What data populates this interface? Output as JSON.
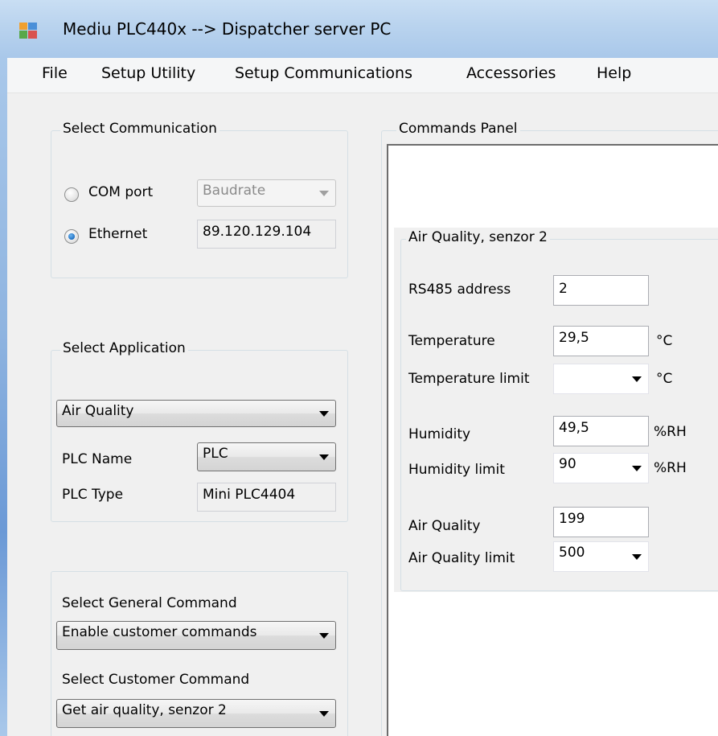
{
  "window": {
    "title": "Mediu PLC440x --> Dispatcher server PC"
  },
  "menu": {
    "file": "File",
    "setup_utility": "Setup Utility",
    "setup_communications": "Setup Communications",
    "accessories": "Accessories",
    "help": "Help"
  },
  "communication": {
    "title": "Select Communication",
    "com_port_label": "COM port",
    "baudrate_placeholder": "Baudrate",
    "ethernet_label": "Ethernet",
    "ip_address": "89.120.129.104",
    "selected": "Ethernet"
  },
  "application": {
    "title": "Select Application",
    "selected": "Air Quality",
    "plc_name_label": "PLC Name",
    "plc_name_value": "PLC",
    "plc_type_label": "PLC Type",
    "plc_type_value": "Mini PLC4404"
  },
  "commands": {
    "general_label": "Select General Command",
    "general_value": "Enable customer commands",
    "customer_label": "Select Customer Command",
    "customer_value": "Get air quality, senzor 2"
  },
  "commands_panel": {
    "title": "Commands Panel",
    "sensor_group": {
      "title": "Air Quality, senzor 2",
      "rs485_label": "RS485 address",
      "rs485_value": "2",
      "temperature_label": "Temperature",
      "temperature_value": "29,5",
      "temperature_unit": "°C",
      "temperature_limit_label": "Temperature limit",
      "temperature_limit_value": "",
      "temperature_limit_unit": "°C",
      "humidity_label": "Humidity",
      "humidity_value": "49,5",
      "humidity_unit": "%RH",
      "humidity_limit_label": "Humidity limit",
      "humidity_limit_value": "90",
      "humidity_limit_unit": "%RH",
      "air_quality_label": "Air Quality",
      "air_quality_value": "199",
      "air_quality_limit_label": "Air Quality limit",
      "air_quality_limit_value": "500"
    }
  },
  "colors": {
    "titlebar": "#b9d3ee",
    "group_border": "#d5dfe5",
    "radio_checked": "#1d6fc2",
    "window_bg": "#f0f0f0"
  }
}
